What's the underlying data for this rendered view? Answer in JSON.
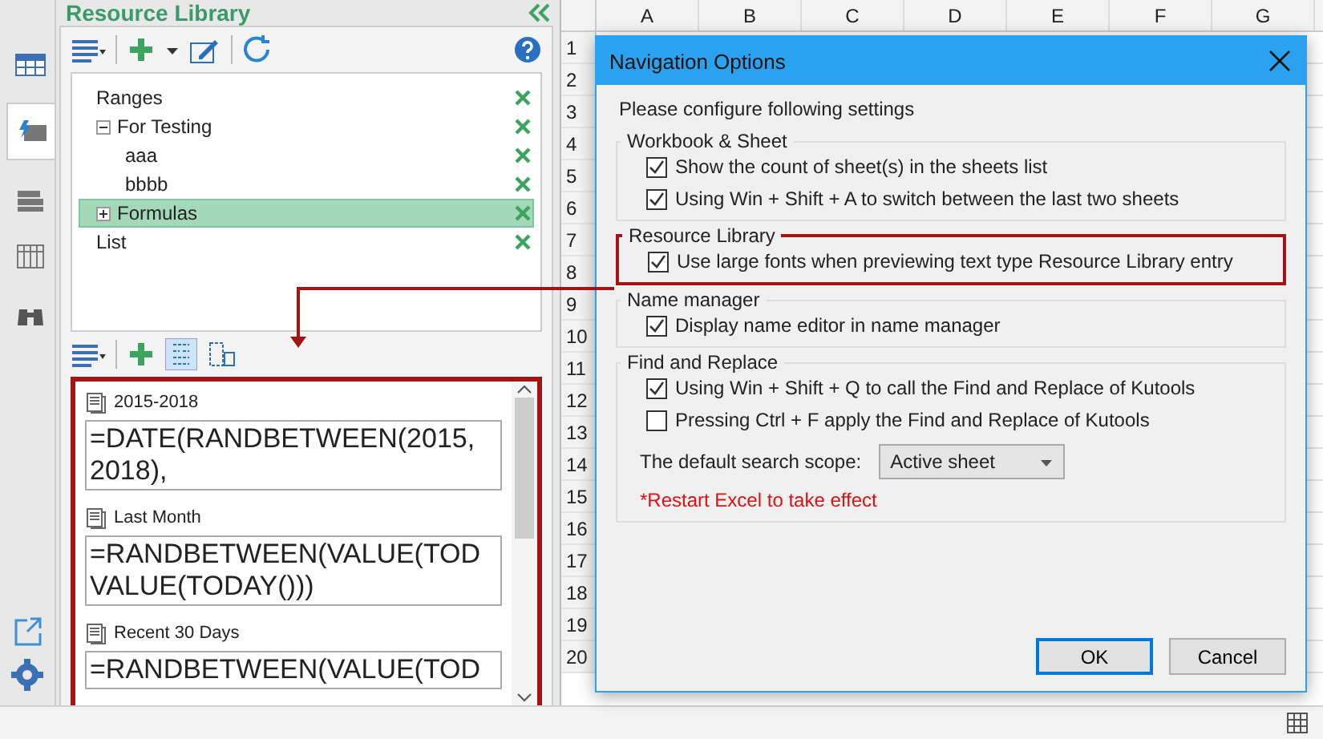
{
  "panel": {
    "title": "Resource Library",
    "tree": [
      {
        "label": "Ranges",
        "selected": false
      },
      {
        "label": "For Testing",
        "selected": false,
        "expanded": true,
        "children": [
          {
            "label": "aaa",
            "selected": false
          },
          {
            "label": "bbbb",
            "selected": false
          }
        ]
      },
      {
        "label": "Formulas",
        "selected": true,
        "expanded": false
      },
      {
        "label": "List",
        "selected": false
      }
    ],
    "entries": [
      {
        "title": "2015-2018",
        "formula": [
          "=DATE(RANDBETWEEN(2015,",
          "2018),"
        ]
      },
      {
        "title": "Last Month",
        "formula": [
          "=RANDBETWEEN(VALUE(TOD",
          "VALUE(TODAY()))"
        ]
      },
      {
        "title": "Recent 30 Days",
        "formula": [
          "=RANDBETWEEN(VALUE(TOD"
        ]
      }
    ]
  },
  "sheet": {
    "columns": [
      "A",
      "B",
      "C",
      "D",
      "E",
      "F",
      "G"
    ],
    "rows": [
      "1",
      "2",
      "3",
      "4",
      "5",
      "6",
      "7",
      "8",
      "9",
      "10",
      "11",
      "12",
      "13",
      "14",
      "15",
      "16",
      "17",
      "18",
      "19",
      "20"
    ]
  },
  "dialog": {
    "title": "Navigation Options",
    "intro": "Please configure following settings",
    "groups": [
      {
        "title": "Workbook & Sheet",
        "highlighted": false,
        "items": [
          {
            "kind": "checkbox",
            "label": "Show the count of sheet(s) in the sheets list",
            "checked": true
          },
          {
            "kind": "checkbox",
            "label": "Using Win + Shift + A to switch between the last two sheets",
            "checked": true
          }
        ]
      },
      {
        "title": "Resource Library",
        "highlighted": true,
        "items": [
          {
            "kind": "checkbox",
            "label": "Use large fonts when previewing text type Resource Library entry",
            "checked": true
          }
        ]
      },
      {
        "title": "Name manager",
        "highlighted": false,
        "items": [
          {
            "kind": "checkbox",
            "label": "Display name editor in name manager",
            "checked": true
          }
        ]
      },
      {
        "title": "Find and Replace",
        "highlighted": false,
        "items": [
          {
            "kind": "checkbox",
            "label": "Using Win + Shift + Q to call the Find and Replace of Kutools",
            "checked": true
          },
          {
            "kind": "checkbox",
            "label": "Pressing Ctrl + F apply the Find and Replace of Kutools",
            "checked": false
          },
          {
            "kind": "select",
            "label": "The default search scope:",
            "value": "Active sheet"
          },
          {
            "kind": "note",
            "label": "*Restart Excel to take effect"
          }
        ]
      }
    ],
    "buttons": [
      {
        "label": "OK",
        "default": true
      },
      {
        "label": "Cancel",
        "default": false
      }
    ]
  }
}
